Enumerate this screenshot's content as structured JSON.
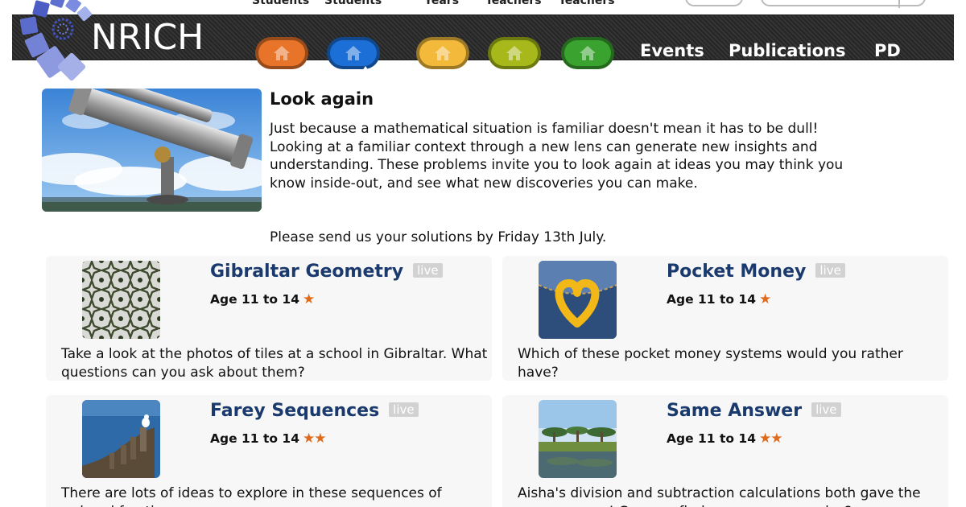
{
  "top_strip": {
    "labels": [
      "Students",
      "Students",
      "Years",
      "Teachers",
      "Teachers"
    ]
  },
  "header": {
    "logo_text": "NRICH",
    "home_buttons": [
      {
        "name": "orange",
        "color": "#e8742a"
      },
      {
        "name": "blue",
        "color": "#1b6fd6"
      },
      {
        "name": "yellow",
        "color": "#f2b93a"
      },
      {
        "name": "lime",
        "color": "#a7b81a"
      },
      {
        "name": "green",
        "color": "#3aa22e"
      }
    ],
    "nav_links": [
      "Events",
      "Publications",
      "PD"
    ]
  },
  "feature": {
    "title": "Look again",
    "description": "Just because a mathematical situation is familiar doesn't mean it has to be dull! Looking at a familiar context through a new lens can generate new insights and understanding. These problems invite you to look again at ideas you may think you know inside-out, and see what new discoveries you can make.",
    "deadline": "Please send us your solutions by Friday 13th July."
  },
  "cards": [
    {
      "title": "Gibraltar Geometry",
      "badge": "live",
      "age": "Age 11 to 14",
      "stars": "★",
      "description": "Take a look at the photos of tiles at a school in Gibraltar. What questions can you ask about them?"
    },
    {
      "title": "Pocket Money",
      "badge": "live",
      "age": "Age 11 to 14",
      "stars": "★",
      "description": "Which of these pocket money systems would you rather have?"
    },
    {
      "title": "Farey Sequences",
      "badge": "live",
      "age": "Age 11 to 14",
      "stars": "★★",
      "description": "There are lots of ideas to explore in these sequences of ordered fractions."
    },
    {
      "title": "Same Answer",
      "badge": "live",
      "age": "Age 11 to 14",
      "stars": "★★",
      "description": "Aisha's division and subtraction calculations both gave the same answer! Can you find any more examples?"
    }
  ],
  "colors": {
    "title_blue": "#1a3a6e",
    "star_orange": "#e06a1b",
    "card_bg": "#f7f7f7"
  }
}
